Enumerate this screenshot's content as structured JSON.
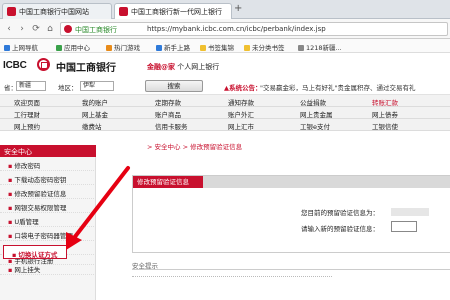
{
  "browser": {
    "tabs": [
      {
        "label": "中国工商银行中国网站"
      },
      {
        "label": "中国工商银行新一代网上银行"
      }
    ],
    "new_tab_symbol": "+",
    "back_symbol": "‹",
    "forward_symbol": "›",
    "reload_symbol": "⟳",
    "home_symbol": "⌂",
    "site_name": "中国工商银行",
    "url": "https://mybank.icbc.com.cn/icbc/perbank/index.jsp",
    "bookmarks": [
      {
        "label": "上网导航",
        "color": "#2f7ad9"
      },
      {
        "label": "应用中心",
        "color": "#3aa14a"
      },
      {
        "label": "热门游戏",
        "color": "#e88b1a"
      },
      {
        "label": "新手上路",
        "color": "#2f7ad9"
      },
      {
        "label": "书签集锦",
        "color": "#f0c030"
      },
      {
        "label": "未分类书签",
        "color": "#f0c030"
      },
      {
        "label": "1218新疆...",
        "color": "#888888"
      }
    ]
  },
  "header": {
    "icbc_text": "ICBC",
    "bank_name": "中国工商银行",
    "brand_tag": "金融@家",
    "brand_sub": "个人网上银行"
  },
  "search_row": {
    "region_label": "省：",
    "region_value": "新疆",
    "city_label": "地区：",
    "city_value": "伊犁",
    "search_button": "搜索",
    "notice_label": "▲系统公告：",
    "notice_text": "\"交易赢金彩，马上有好礼\"贵金属积存、通过交易有礼"
  },
  "menu": {
    "rows": [
      [
        "欢迎页面",
        "我的账户",
        "定期存款",
        "通知存款",
        "公益捐款",
        "转账汇款"
      ],
      [
        "工行理财",
        "网上基金",
        "账户商品",
        "账户外汇",
        "网上贵金属",
        "网上债券"
      ],
      [
        "网上预约",
        "缴费站",
        "信用卡服务",
        "网上汇市",
        "工银e支付",
        "工银信使"
      ]
    ]
  },
  "sidebar": {
    "title": "安全中心",
    "items": [
      "修改密码",
      "下载动态密码密钥",
      "修改预留验证信息",
      "网银交易权限管理",
      "U盾管理",
      "口袋电子密码器管理",
      "口令卡管理",
      "手机银行注册",
      "切换认证方式",
      "网上挂失"
    ]
  },
  "main": {
    "breadcrumb": "> 安全中心 > 修改预留验证信息",
    "panel_title": "修改预留验证信息",
    "current_label": "您目前的预留验证信息为：",
    "new_label": "请输入新的预留验证信息：",
    "section2_title": "安全提示"
  },
  "colors": {
    "brand_red": "#c8102e",
    "sidebar_bg": "#f5f5f5",
    "menu_bg": "#f2f2f2"
  }
}
